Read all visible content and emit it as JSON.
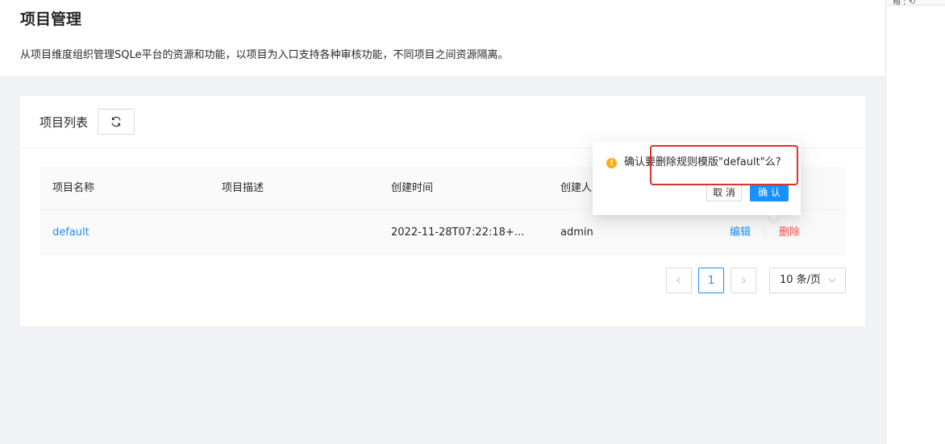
{
  "side": {
    "top_text": "箱 ; ⟲"
  },
  "header": {
    "title": "项目管理",
    "description": "从项目维度组织管理SQLe平台的资源和功能，以项目为入口支持各种审核功能，不同项目之间资源隔离。"
  },
  "card": {
    "title": "项目列表",
    "refresh_icon": "reload-icon"
  },
  "table": {
    "columns": [
      "项目名称",
      "项目描述",
      "创建时间",
      "创建人"
    ],
    "rows": [
      {
        "name": "default",
        "description": "",
        "created_at": "2022-11-28T07:22:18+...",
        "creator": "admin",
        "edit": "编辑",
        "delete": "删除"
      }
    ]
  },
  "pagination": {
    "prev_icon": "chevron-left-icon",
    "current": "1",
    "next_icon": "chevron-right-icon",
    "page_size": "10 条/页"
  },
  "popconfirm": {
    "icon": "exclamation-circle-icon",
    "message": "确认要删除规则模版\"default\"么?",
    "cancel": "取 消",
    "ok": "确 认"
  },
  "colors": {
    "primary": "#1890ff",
    "danger": "#ff4d4f",
    "warning": "#faad14",
    "highlight": "#e0302b"
  }
}
